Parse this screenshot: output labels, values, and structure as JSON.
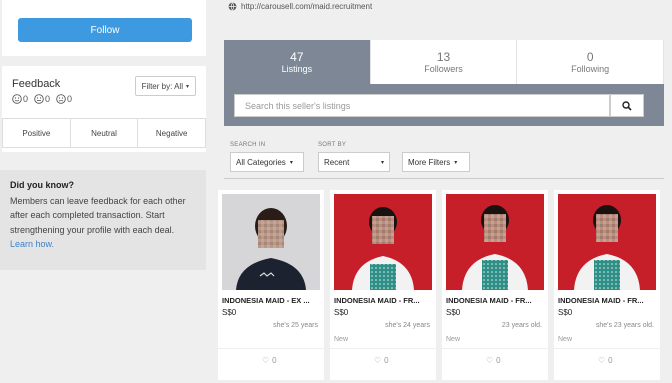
{
  "follow": {
    "label": "Follow"
  },
  "feedback": {
    "title": "Feedback",
    "filter_label": "Filter by: All",
    "counts": [
      {
        "icon": "happy-face-icon",
        "value": "0"
      },
      {
        "icon": "neutral-face-icon",
        "value": "0"
      },
      {
        "icon": "sad-face-icon",
        "value": "0"
      }
    ],
    "tabs": [
      "Positive",
      "Neutral",
      "Negative"
    ]
  },
  "tip": {
    "title": "Did you know?",
    "body": "Members can leave feedback for each other after each completed transaction. Start strengthening your profile with each deal.",
    "link": "Learn how."
  },
  "profile": {
    "url": "http://carousell.com/maid.recruitment"
  },
  "stats": [
    {
      "value": "47",
      "label": "Listings"
    },
    {
      "value": "13",
      "label": "Followers"
    },
    {
      "value": "0",
      "label": "Following"
    }
  ],
  "search": {
    "placeholder": "Search this seller's listings"
  },
  "filters": {
    "search_in_label": "SEARCH IN",
    "search_in_value": "All Categories",
    "sort_by_label": "SORT BY",
    "sort_by_value": "Recent",
    "more_label": "More Filters"
  },
  "listings": [
    {
      "title": "INDONESIA MAID - EX ...",
      "price": "S$0",
      "desc": "she's 25 years",
      "condition": "",
      "likes": "0"
    },
    {
      "title": "INDONESIA MAID - FR...",
      "price": "S$0",
      "desc": "she's 24 years",
      "condition": "New",
      "likes": "0"
    },
    {
      "title": "INDONESIA MAID - FR...",
      "price": "S$0",
      "desc": "23 years old.",
      "condition": "New",
      "likes": "0"
    },
    {
      "title": "INDONESIA MAID - FR...",
      "price": "S$0",
      "desc": "she's 23 years old.",
      "condition": "New",
      "likes": "0"
    }
  ]
}
